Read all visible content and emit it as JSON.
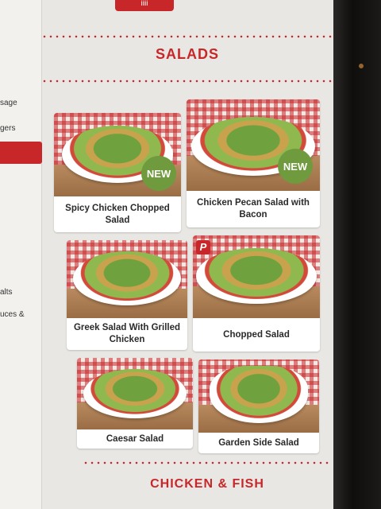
{
  "top_button": {
    "label": "iiii"
  },
  "sidebar": {
    "items": [
      {
        "label": "sage"
      },
      {
        "label": "gers"
      },
      {
        "label": "alts"
      },
      {
        "label": "uces &"
      }
    ]
  },
  "sections": {
    "salads_title": "SALADS",
    "next_title": "CHICKEN & FISH"
  },
  "menu_items": [
    {
      "name": "Spicy Chicken Chopped Salad",
      "badge": "NEW"
    },
    {
      "name": "Chicken Pecan Salad with Bacon",
      "badge": "NEW"
    },
    {
      "name": "Greek Salad With Grilled Chicken"
    },
    {
      "name": "Chopped Salad",
      "logo": "P"
    },
    {
      "name": "Caesar Salad"
    },
    {
      "name": "Garden Side Salad"
    }
  ],
  "colors": {
    "accent": "#c8272a",
    "badge_green": "#6f9a3d"
  }
}
